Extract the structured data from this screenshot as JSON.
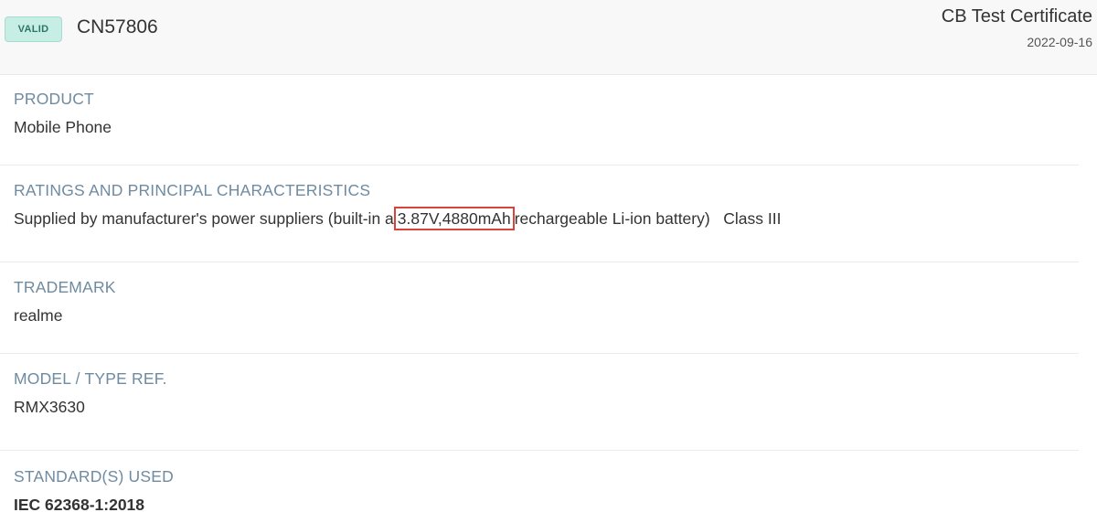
{
  "header": {
    "status_badge": "VALID",
    "certificate_id": "CN57806",
    "certificate_type": "CB Test Certificate",
    "date": "2022-09-16"
  },
  "sections": {
    "product": {
      "label": "PRODUCT",
      "value": "Mobile Phone"
    },
    "ratings": {
      "label": "RATINGS AND PRINCIPAL CHARACTERISTICS",
      "value_before": "Supplied by manufacturer's power suppliers (built-in a",
      "value_highlight": "3.87V,4880mAh",
      "value_after": "rechargeable Li-ion battery)   Class III"
    },
    "trademark": {
      "label": "TRADEMARK",
      "value": "realme"
    },
    "model": {
      "label": "MODEL / TYPE REF.",
      "value": "RMX3630"
    },
    "standards": {
      "label": "STANDARD(S) USED",
      "value": "IEC 62368-1:2018"
    }
  },
  "colors": {
    "badge_bg": "#c7eee4",
    "badge_text": "#2e7664",
    "label_text": "#6e8ba1",
    "highlight_border": "#d9443a"
  }
}
